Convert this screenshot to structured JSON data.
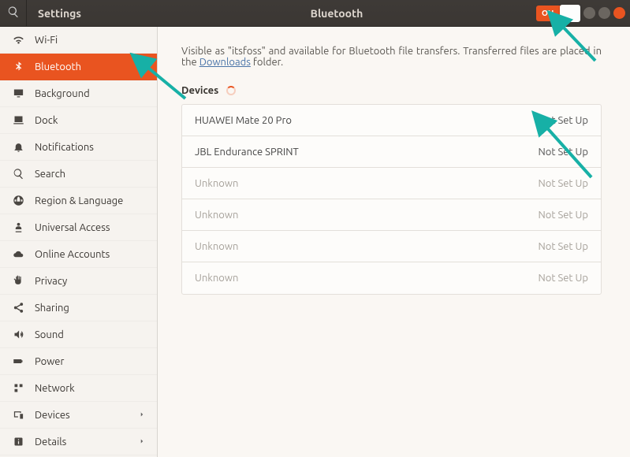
{
  "titlebar": {
    "app": "Settings",
    "page": "Bluetooth",
    "toggle_label": "ON"
  },
  "sidebar": {
    "items": [
      {
        "id": "wifi",
        "label": "Wi-Fi",
        "icon": "wifi"
      },
      {
        "id": "bluetooth",
        "label": "Bluetooth",
        "icon": "bluetooth",
        "active": true
      },
      {
        "id": "background",
        "label": "Background",
        "icon": "display"
      },
      {
        "id": "dock",
        "label": "Dock",
        "icon": "dock"
      },
      {
        "id": "notifications",
        "label": "Notifications",
        "icon": "bell"
      },
      {
        "id": "search",
        "label": "Search",
        "icon": "search"
      },
      {
        "id": "region",
        "label": "Region & Language",
        "icon": "globe"
      },
      {
        "id": "universal",
        "label": "Universal Access",
        "icon": "person"
      },
      {
        "id": "online",
        "label": "Online Accounts",
        "icon": "cloud"
      },
      {
        "id": "privacy",
        "label": "Privacy",
        "icon": "hand"
      },
      {
        "id": "sharing",
        "label": "Sharing",
        "icon": "share"
      },
      {
        "id": "sound",
        "label": "Sound",
        "icon": "speaker"
      },
      {
        "id": "power",
        "label": "Power",
        "icon": "battery"
      },
      {
        "id": "network",
        "label": "Network",
        "icon": "network"
      },
      {
        "id": "devices",
        "label": "Devices",
        "icon": "devices",
        "chevron": true
      },
      {
        "id": "details",
        "label": "Details",
        "icon": "info",
        "chevron": true
      }
    ]
  },
  "main": {
    "desc_prefix": "Visible as \"itsfoss\" and available for Bluetooth file transfers. Transferred files are placed in the ",
    "desc_link": "Downloads",
    "desc_suffix": " folder.",
    "devices_label": "Devices",
    "devices": [
      {
        "name": "HUAWEI Mate 20 Pro",
        "status": "Not Set Up",
        "dim": false
      },
      {
        "name": "JBL Endurance SPRINT",
        "status": "Not Set Up",
        "dim": false
      },
      {
        "name": "Unknown",
        "status": "Not Set Up",
        "dim": true
      },
      {
        "name": "Unknown",
        "status": "Not Set Up",
        "dim": true
      },
      {
        "name": "Unknown",
        "status": "Not Set Up",
        "dim": true
      },
      {
        "name": "Unknown",
        "status": "Not Set Up",
        "dim": true
      }
    ]
  }
}
